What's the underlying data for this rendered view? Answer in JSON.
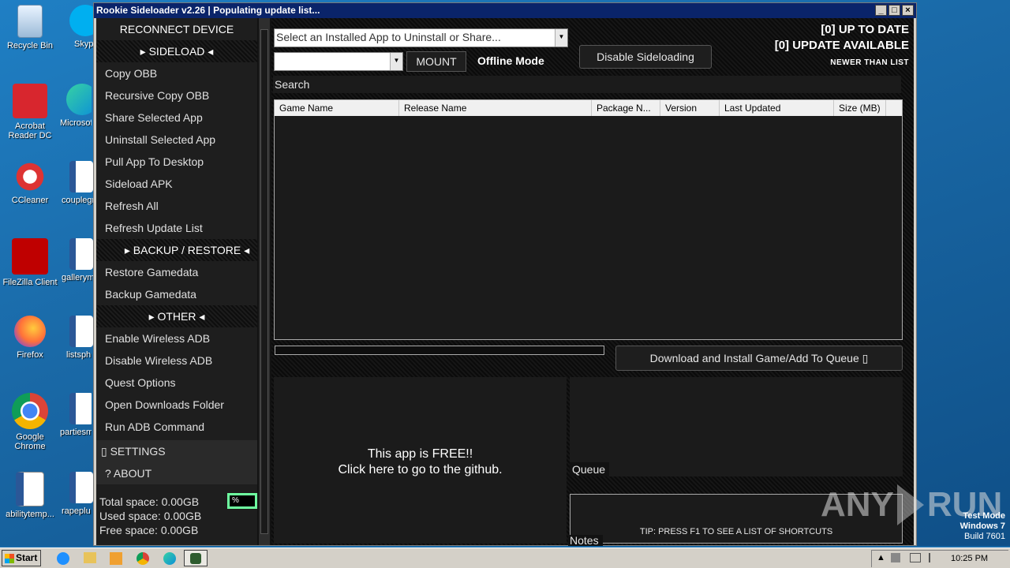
{
  "desktop": {
    "icons": [
      {
        "label": "Recycle Bin",
        "icon": "recycle-bin-icon"
      },
      {
        "label": "Acrobat Reader DC",
        "icon": "acrobat-icon"
      },
      {
        "label": "CCleaner",
        "icon": "ccleaner-icon"
      },
      {
        "label": "FileZilla Client",
        "icon": "filezilla-icon"
      },
      {
        "label": "Firefox",
        "icon": "firefox-icon"
      },
      {
        "label": "Google Chrome",
        "icon": "chrome-icon"
      },
      {
        "label": "abilitytemp...",
        "icon": "word-doc-icon"
      }
    ],
    "icons_col2": [
      {
        "label": "Skyp",
        "icon": "skype-icon"
      },
      {
        "label": "Microsof",
        "icon": "edge-icon"
      },
      {
        "label": "couplegr",
        "icon": "word-doc-icon"
      },
      {
        "label": "galleryma",
        "icon": "word-doc-icon"
      },
      {
        "label": "listsph",
        "icon": "word-doc-icon"
      },
      {
        "label": "partiesm",
        "icon": "word-doc-icon"
      },
      {
        "label": "rapeplu",
        "icon": "word-doc-icon"
      }
    ]
  },
  "window": {
    "title": "Rookie Sideloader v2.26 | Populating update list...",
    "minimize": "_",
    "maximize": "□",
    "close": "×"
  },
  "sidebar": {
    "reconnect": "RECONNECT DEVICE",
    "sideload_header": "▸ SIDELOAD ◂",
    "sideload_items": [
      "Copy OBB",
      "Recursive Copy OBB",
      "Share Selected App",
      "Uninstall Selected App",
      "Pull App To Desktop",
      "Sideload APK",
      "Refresh All",
      "Refresh Update List"
    ],
    "backup_header": "▸ BACKUP / RESTORE ◂",
    "backup_items": [
      "Restore Gamedata",
      "Backup Gamedata"
    ],
    "other_header": "▸ OTHER ◂",
    "other_items": [
      "Enable  Wireless ADB",
      "Disable Wireless ADB",
      "Quest Options",
      "Open Downloads Folder",
      "Run ADB Command"
    ],
    "settings": "▯ SETTINGS",
    "about": "?   ABOUT",
    "total_space": "Total space: 0.00GB",
    "used_space": "Used space: 0.00GB",
    "free_space": "Free space: 0.00GB",
    "percent": "%"
  },
  "main": {
    "app_select_placeholder": "Select an Installed App to Uninstall or Share...",
    "mount_label": "MOUNT",
    "offline_mode": "Offline Mode",
    "disable_sideloading": "Disable Sideloading",
    "up_to_date": "[0] UP TO DATE",
    "update_available": "[0] UPDATE AVAILABLE",
    "newer_than_list": "NEWER THAN LIST",
    "search_label": "Search",
    "columns": [
      "Game Name",
      "Release Name",
      "Package N...",
      "Version",
      "Last Updated",
      "Size (MB)"
    ],
    "download_button": "Download  and  Install  Game/Add  To  Queue ▯",
    "free_line1": "This app is FREE!!",
    "free_line2": "Click here to go to the github.",
    "queue_label": "Queue",
    "notes_label": "Notes",
    "tip": "TIP: PRESS F1 TO SEE A LIST OF SHORTCUTS"
  },
  "watermark": {
    "text_left": "ANY",
    "text_right": "RUN"
  },
  "taskbar": {
    "start": "Start",
    "time": "10:25 PM",
    "test_mode": "Test Mode",
    "windows": "Windows 7",
    "build": "Build 7601"
  },
  "colors": {
    "accent_green": "#6effa0",
    "title_blue": "#0a246a"
  }
}
